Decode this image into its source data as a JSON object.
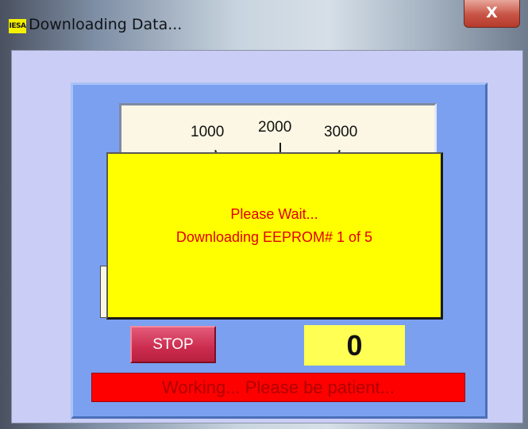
{
  "window": {
    "title": "Downloading Data...",
    "app_icon_text": "IESA",
    "close_glyph": "X"
  },
  "gauge": {
    "tick_labels": [
      "1000",
      "2000",
      "3000"
    ],
    "arc_color": "#19d633"
  },
  "controls": {
    "stop_label": "STOP",
    "counter_value": "0"
  },
  "status": {
    "message": "Working... Please be patient..."
  },
  "popup": {
    "line1": "Please Wait...",
    "line2": "Downloading EEPROM# 1 of 5"
  },
  "colors": {
    "panel": "#7ba0f0",
    "popup": "#ffff00",
    "popup_text": "#e00000",
    "status_bar": "#ff0000",
    "stop_button": "#cb2c4f",
    "counter_bg": "#ffff54"
  }
}
